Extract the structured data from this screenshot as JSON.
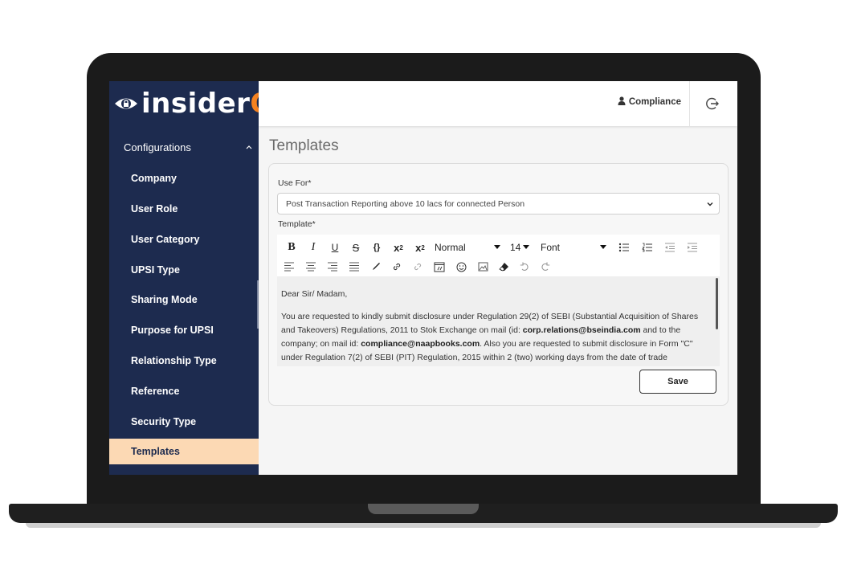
{
  "app": {
    "logo_prefix": "insider",
    "logo_q": "Q"
  },
  "sidebar": {
    "section_label": "Configurations",
    "items": [
      {
        "label": "Company"
      },
      {
        "label": "User Role"
      },
      {
        "label": "User Category"
      },
      {
        "label": "UPSI Type"
      },
      {
        "label": "Sharing Mode"
      },
      {
        "label": "Purpose for UPSI"
      },
      {
        "label": "Relationship Type"
      },
      {
        "label": "Reference"
      },
      {
        "label": "Security Type"
      },
      {
        "label": "Templates"
      }
    ],
    "active_item": "Templates"
  },
  "header": {
    "user_name": "Compliance"
  },
  "main": {
    "page_title": "Templates",
    "use_for_label": "Use For*",
    "use_for_value": "Post Transaction Reporting above 10 lacs for connected Person",
    "template_label": "Template*",
    "toolbar": {
      "heading_value": "Normal",
      "size_value": "14",
      "font_value": "Font"
    },
    "editor": {
      "greeting": "Dear Sir/ Madam,",
      "p1_a": "You are requested to kindly submit disclosure under Regulation 29(2) of SEBI (Substantial Acquisition of Shares and Takeovers) Regulations, 2011 to Stok Exchange on mail (id: ",
      "p1_email1": "corp.relations@bseindia.com",
      "p1_b": " and to the company; on mail id: ",
      "p1_email2": "compliance@naapbooks.com",
      "p1_c": ". Also you are requested to submit disclosure in Form \"C\" under Regulation 7(2) of SEBI (PIT) Regulation, 2015 within 2 (two) working days from the date of trade"
    },
    "save_label": "Save"
  },
  "colors": {
    "sidebar_bg": "#1d2b4f",
    "active_item_bg": "#fcd9b4",
    "logo_accent": "#f58220"
  }
}
